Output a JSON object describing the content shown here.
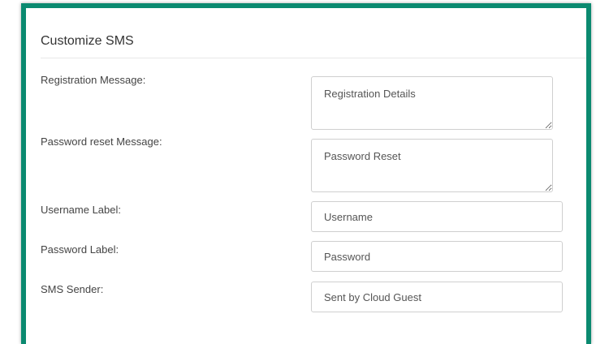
{
  "panel": {
    "title": "Customize SMS"
  },
  "fields": {
    "registration_message": {
      "label": "Registration Message:",
      "value": "Registration Details"
    },
    "password_reset_message": {
      "label": "Password reset Message:",
      "value": "Password Reset"
    },
    "username_label": {
      "label": "Username Label:",
      "value": "Username"
    },
    "password_label": {
      "label": "Password Label:",
      "value": "Password"
    },
    "sms_sender": {
      "label": "SMS Sender:",
      "value": "Sent by Cloud Guest"
    }
  },
  "colors": {
    "frame_border": "#0b8a70"
  }
}
